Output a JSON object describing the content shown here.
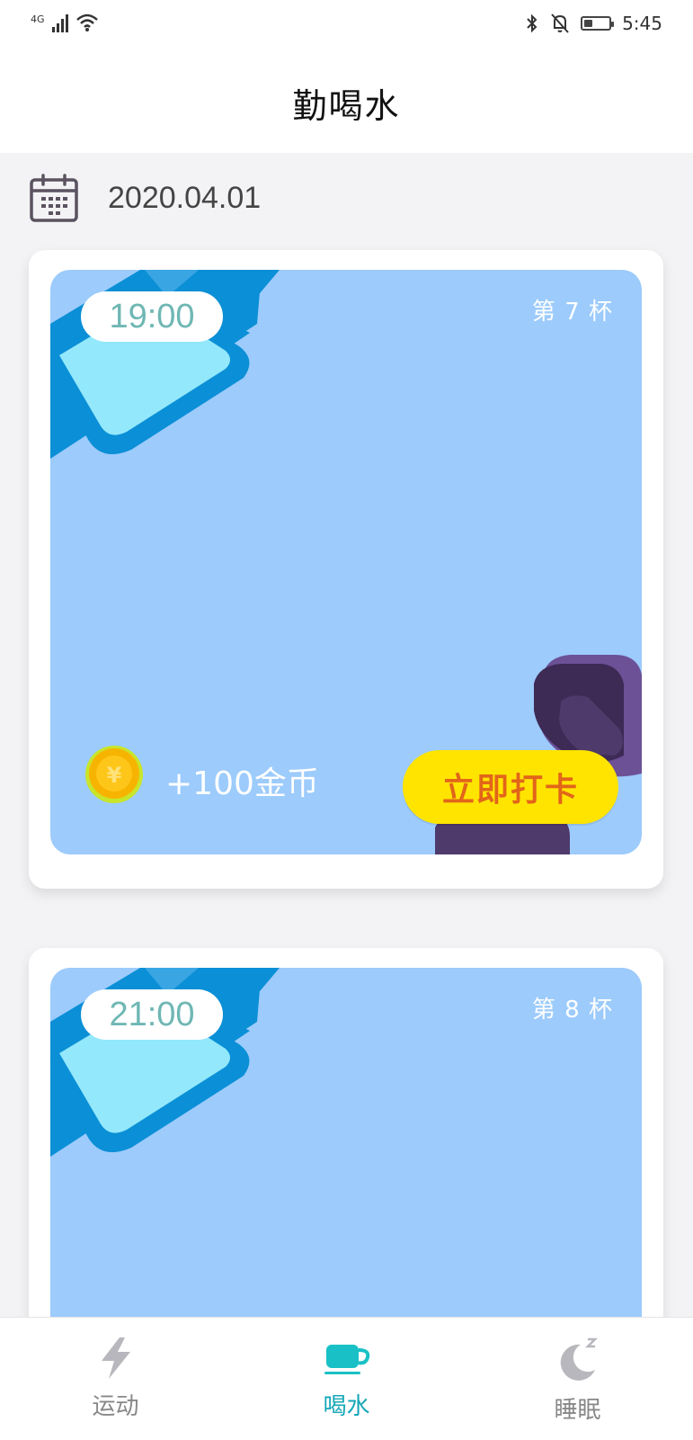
{
  "status_bar": {
    "network_label": "4G",
    "time": "5:45",
    "battery_level": 0.35
  },
  "header": {
    "title": "勤喝水"
  },
  "date": {
    "value": "2020.04.01",
    "icon": "calendar-icon"
  },
  "cards": [
    {
      "time": "19:00",
      "cup_label": "第 7 杯",
      "reward": "+100金币",
      "button_label": "立即打卡"
    },
    {
      "time": "21:00",
      "cup_label": "第 8 杯"
    }
  ],
  "bottom_nav": {
    "items": [
      {
        "label": "运动",
        "icon": "lightning-icon",
        "active": false
      },
      {
        "label": "喝水",
        "icon": "cup-icon",
        "active": true
      },
      {
        "label": "睡眠",
        "icon": "moon-icon",
        "active": false
      }
    ]
  },
  "colors": {
    "card_blue": "#9ccbfc",
    "button_yellow": "#ffe400",
    "button_text_orange": "#e2651a",
    "time_text_teal": "#6fb7b4",
    "nav_active": "#16a7b7",
    "nav_inactive": "#888888"
  }
}
